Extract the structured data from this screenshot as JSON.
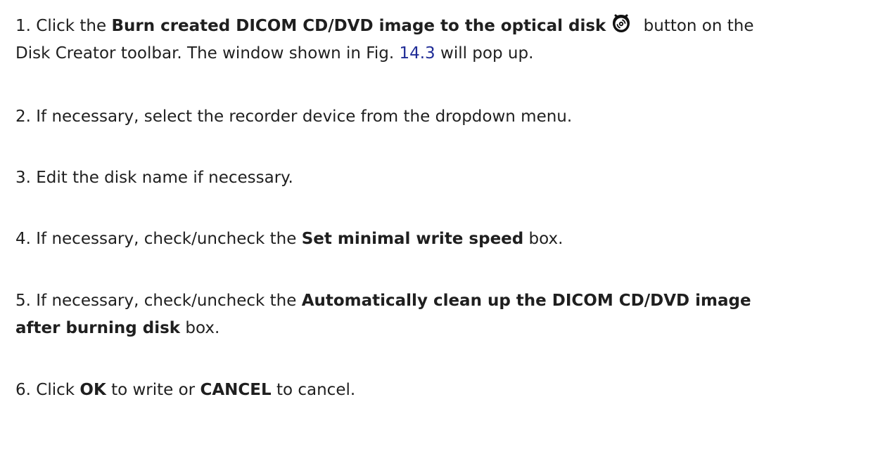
{
  "steps": [
    {
      "number": "1.",
      "line1": {
        "pre": "Click the ",
        "bold": "Burn created DICOM CD/DVD image to the optical disk",
        "icon": "burn-disc-icon",
        "post": " button on the"
      },
      "line2": {
        "pre": "Disk Creator toolbar. The window shown in Fig. ",
        "link": "14.3",
        "post": " will pop up."
      }
    },
    {
      "number": "2.",
      "text": "If necessary, select the recorder device from the dropdown menu."
    },
    {
      "number": "3.",
      "text": "Edit the disk name if necessary."
    },
    {
      "number": "4.",
      "pre": "If necessary, check/uncheck the ",
      "bold": "Set minimal write speed",
      "post": " box."
    },
    {
      "number": "5.",
      "pre": "If necessary, check/uncheck the ",
      "bold1": "Automatically clean up the DICOM CD/DVD image",
      "bold2": "after burning disk",
      "post": " box."
    },
    {
      "number": "6.",
      "pre": "Click ",
      "bold1": "OK",
      "mid": " to write or ",
      "bold2": "CANCEL",
      "post": " to cancel."
    }
  ]
}
